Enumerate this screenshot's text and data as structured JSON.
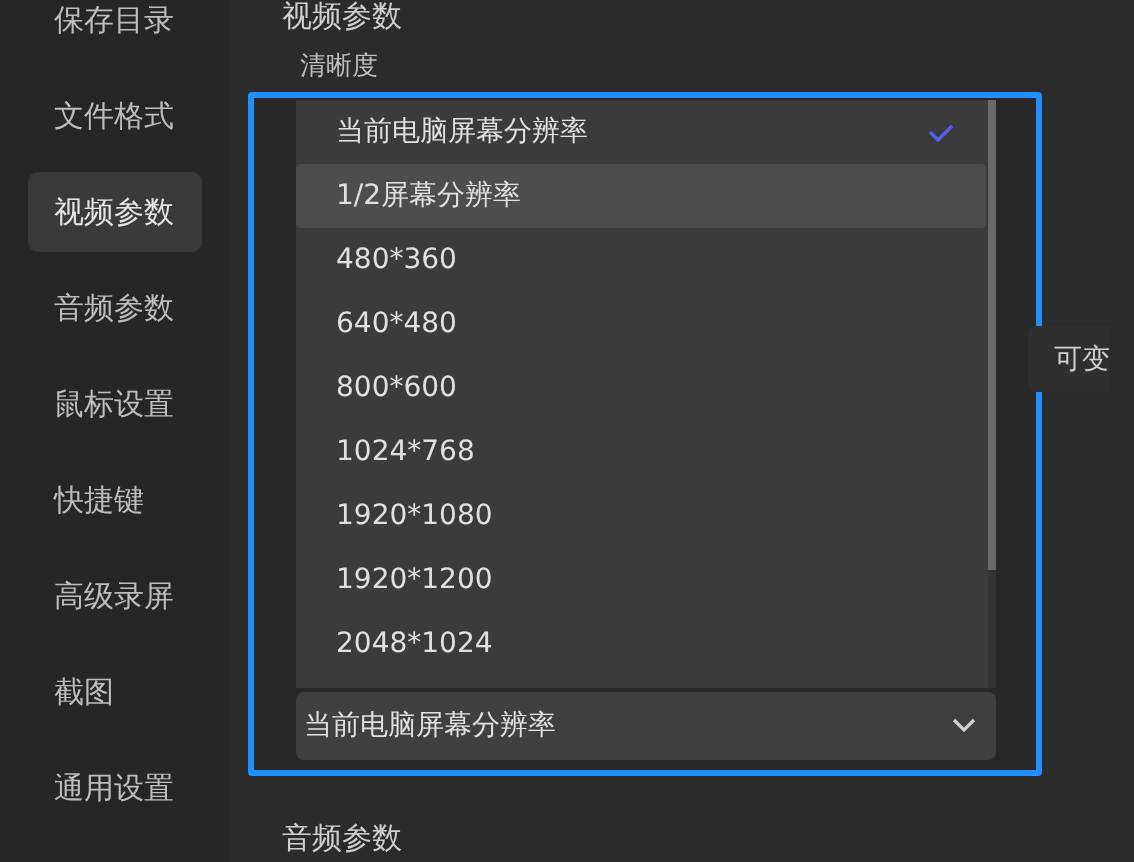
{
  "sidebar": {
    "items": [
      {
        "label": "保存目录",
        "selected": false
      },
      {
        "label": "文件格式",
        "selected": false
      },
      {
        "label": "视频参数",
        "selected": true
      },
      {
        "label": "音频参数",
        "selected": false
      },
      {
        "label": "鼠标设置",
        "selected": false
      },
      {
        "label": "快捷键",
        "selected": false
      },
      {
        "label": "高级录屏",
        "selected": false
      },
      {
        "label": "截图",
        "selected": false
      },
      {
        "label": "通用设置",
        "selected": false
      }
    ]
  },
  "main": {
    "heading": "视频参数",
    "field_label": "清晰度",
    "dropdown": {
      "options": [
        {
          "label": "当前电脑屏幕分辨率",
          "selected": true,
          "hovered": false
        },
        {
          "label": "1/2屏幕分辨率",
          "selected": false,
          "hovered": true
        },
        {
          "label": "480*360",
          "selected": false,
          "hovered": false
        },
        {
          "label": "640*480",
          "selected": false,
          "hovered": false
        },
        {
          "label": "800*600",
          "selected": false,
          "hovered": false
        },
        {
          "label": "1024*768",
          "selected": false,
          "hovered": false
        },
        {
          "label": "1920*1080",
          "selected": false,
          "hovered": false
        },
        {
          "label": "1920*1200",
          "selected": false,
          "hovered": false
        },
        {
          "label": "2048*1024",
          "selected": false,
          "hovered": false
        }
      ],
      "value": "当前电脑屏幕分辨率"
    },
    "side_option": "可变",
    "next_heading": "音频参数"
  }
}
